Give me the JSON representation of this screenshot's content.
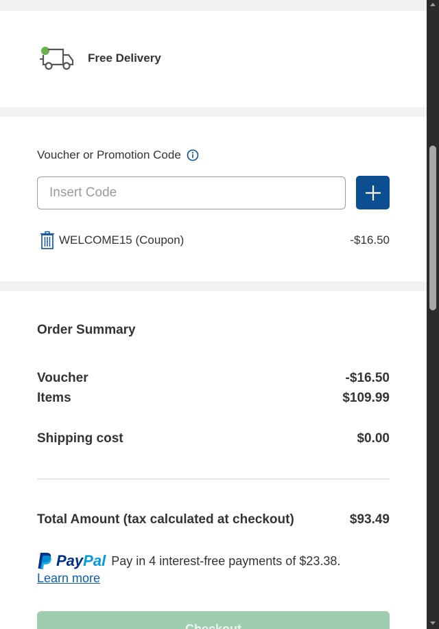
{
  "delivery": {
    "label": "Free Delivery",
    "icon": "truck-icon"
  },
  "voucher": {
    "title": "Voucher or Promotion Code",
    "info_icon": "info-icon",
    "input_placeholder": "Insert Code",
    "input_value": "",
    "add_icon": "plus-icon",
    "applied": {
      "label": "WELCOME15 (Coupon)",
      "amount": "-$16.50",
      "remove_icon": "trash-icon"
    }
  },
  "summary": {
    "title": "Order Summary",
    "lines": [
      {
        "label": "Voucher",
        "value": "-$16.50"
      },
      {
        "label": "Items",
        "value": "$109.99"
      },
      {
        "label": "Shipping cost",
        "value": "$0.00"
      }
    ],
    "total": {
      "label": "Total Amount (tax calculated at checkout)",
      "value": "$93.49"
    }
  },
  "paypal": {
    "brand_pay": "Pay",
    "brand_pal": "Pal",
    "message": "Pay in 4 interest-free payments of $23.38.",
    "link": "Learn more"
  },
  "checkout": {
    "label": "Checkout"
  },
  "colors": {
    "primary": "#0b4f91",
    "checkout_disabled": "#9fcdb0",
    "delivery_dot": "#6ab04c",
    "paypal_dark": "#003087",
    "paypal_light": "#009cde",
    "link": "#0b5fb0"
  }
}
